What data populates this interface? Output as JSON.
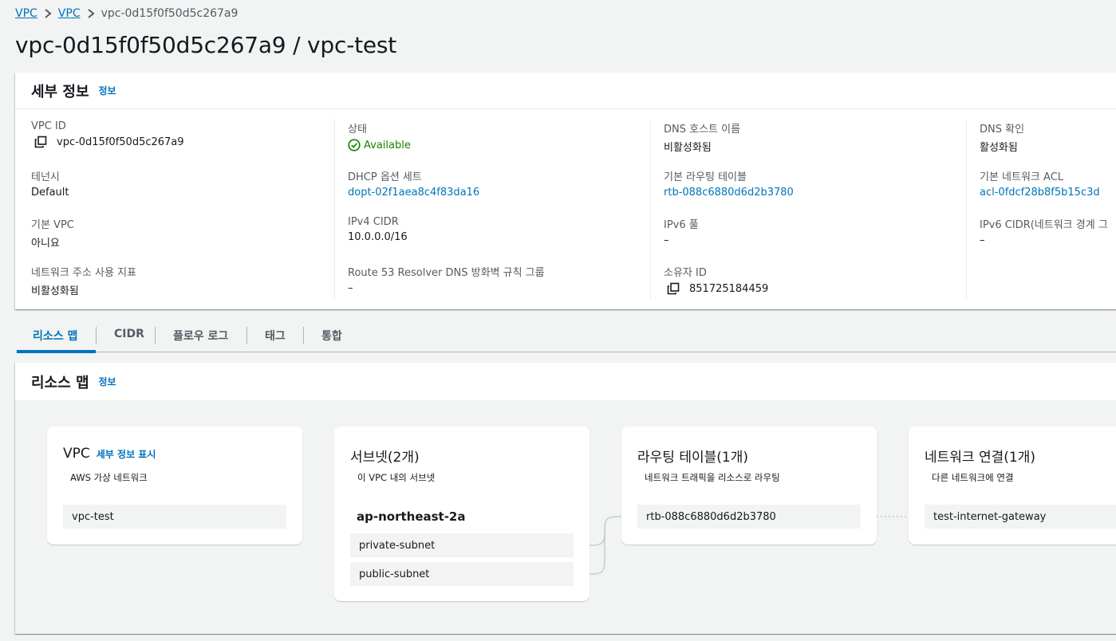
{
  "breadcrumb": {
    "items": [
      "VPC",
      "VPC"
    ],
    "current": "vpc-0d15f0f50d5c267a9"
  },
  "page_title": "vpc-0d15f0f50d5c267a9 / vpc-test",
  "details": {
    "title": "세부 정보",
    "info_label": "정보",
    "col1": {
      "vpc_id_label": "VPC ID",
      "vpc_id_value": "vpc-0d15f0f50d5c267a9",
      "tenancy_label": "테넌시",
      "tenancy_value": "Default",
      "default_vpc_label": "기본 VPC",
      "default_vpc_value": "아니요",
      "network_usage_label": "네트워크 주소 사용 지표",
      "network_usage_value": "비활성화됨"
    },
    "col2": {
      "state_label": "상태",
      "state_value": "Available",
      "dhcp_label": "DHCP 옵션 세트",
      "dhcp_value": "dopt-02f1aea8c4f83da16",
      "ipv4_label": "IPv4 CIDR",
      "ipv4_value": "10.0.0.0/16",
      "route53_label": "Route 53 Resolver DNS 방화벽 규칙 그룹",
      "route53_value": "–"
    },
    "col3": {
      "dns_hostname_label": "DNS 호스트 이름",
      "dns_hostname_value": "비활성화됨",
      "main_rt_label": "기본 라우팅 테이블",
      "main_rt_value": "rtb-088c6880d6d2b3780",
      "ipv6_pool_label": "IPv6 풀",
      "ipv6_pool_value": "–",
      "owner_label": "소유자 ID",
      "owner_value": "851725184459"
    },
    "col4": {
      "dns_resolution_label": "DNS 확인",
      "dns_resolution_value": "활성화됨",
      "main_acl_label": "기본 네트워크 ACL",
      "main_acl_value": "acl-0fdcf28b8f5b15c3d",
      "ipv6_cidr_label": "IPv6 CIDR(네트워크 경계 그",
      "ipv6_cidr_value": "–"
    }
  },
  "tabs": [
    "리소스 맵",
    "CIDR",
    "플로우 로그",
    "태그",
    "통합"
  ],
  "resource_map": {
    "title": "리소스 맵",
    "info_label": "정보",
    "vpc_card": {
      "title": "VPC",
      "detail_link": "세부 정보 표시",
      "subtitle": "AWS 가상 네트워크",
      "item": "vpc-test"
    },
    "subnet_card": {
      "title": "서브넷(2개)",
      "subtitle": "이 VPC 내의 서브넷",
      "az": "ap-northeast-2a",
      "items": [
        "private-subnet",
        "public-subnet"
      ]
    },
    "route_card": {
      "title": "라우팅 테이블(1개)",
      "subtitle": "네트워크 트래픽을 리소스로 라우팅",
      "item": "rtb-088c6880d6d2b3780"
    },
    "network_card": {
      "title": "네트워크 연결(1개)",
      "subtitle": "다른 네트워크에 연결",
      "item": "test-internet-gateway"
    }
  },
  "colors": {
    "link": "#0073bb",
    "success": "#1d8102",
    "text": "#16191f",
    "muted": "#545b64"
  },
  "icons": {
    "copy": "copy-icon",
    "status": "check-circle-icon",
    "separator": "chevron-right-icon"
  }
}
